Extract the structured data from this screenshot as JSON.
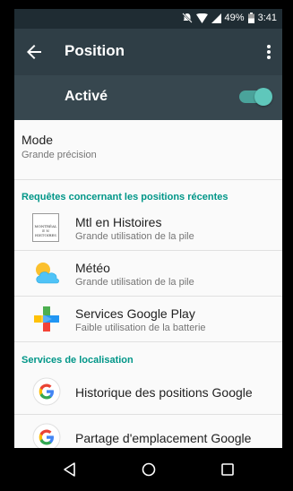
{
  "status_bar": {
    "battery": "49%",
    "time": "3:41"
  },
  "app_bar": {
    "title": "Position"
  },
  "master_switch": {
    "label": "Activé",
    "state": "on",
    "accent": "#4aa39b"
  },
  "mode": {
    "title": "Mode",
    "value": "Grande précision"
  },
  "recent_requests": {
    "header": "Requêtes concernant les positions récentes",
    "items": [
      {
        "title": "Mtl en Histoires",
        "subtitle": "Grande utilisation de la pile",
        "icon": "mtl-histoires-icon",
        "icon_text": [
          "MONTRÉAL",
          "E N",
          "HISTOIRES"
        ]
      },
      {
        "title": "Météo",
        "subtitle": "Grande utilisation de la pile",
        "icon": "weather-icon"
      },
      {
        "title": "Services Google Play",
        "subtitle": "Faible utilisation de la batterie",
        "icon": "google-play-services-icon"
      }
    ]
  },
  "location_services": {
    "header": "Services de localisation",
    "items": [
      {
        "title": "Historique des positions Google",
        "icon": "google-icon"
      },
      {
        "title": "Partage d'emplacement Google",
        "icon": "google-icon"
      }
    ]
  },
  "colors": {
    "status_bar": "#1f2c33",
    "app_bar": "#2f3e46",
    "switch_bar": "#37474f",
    "section_header": "#009688"
  }
}
